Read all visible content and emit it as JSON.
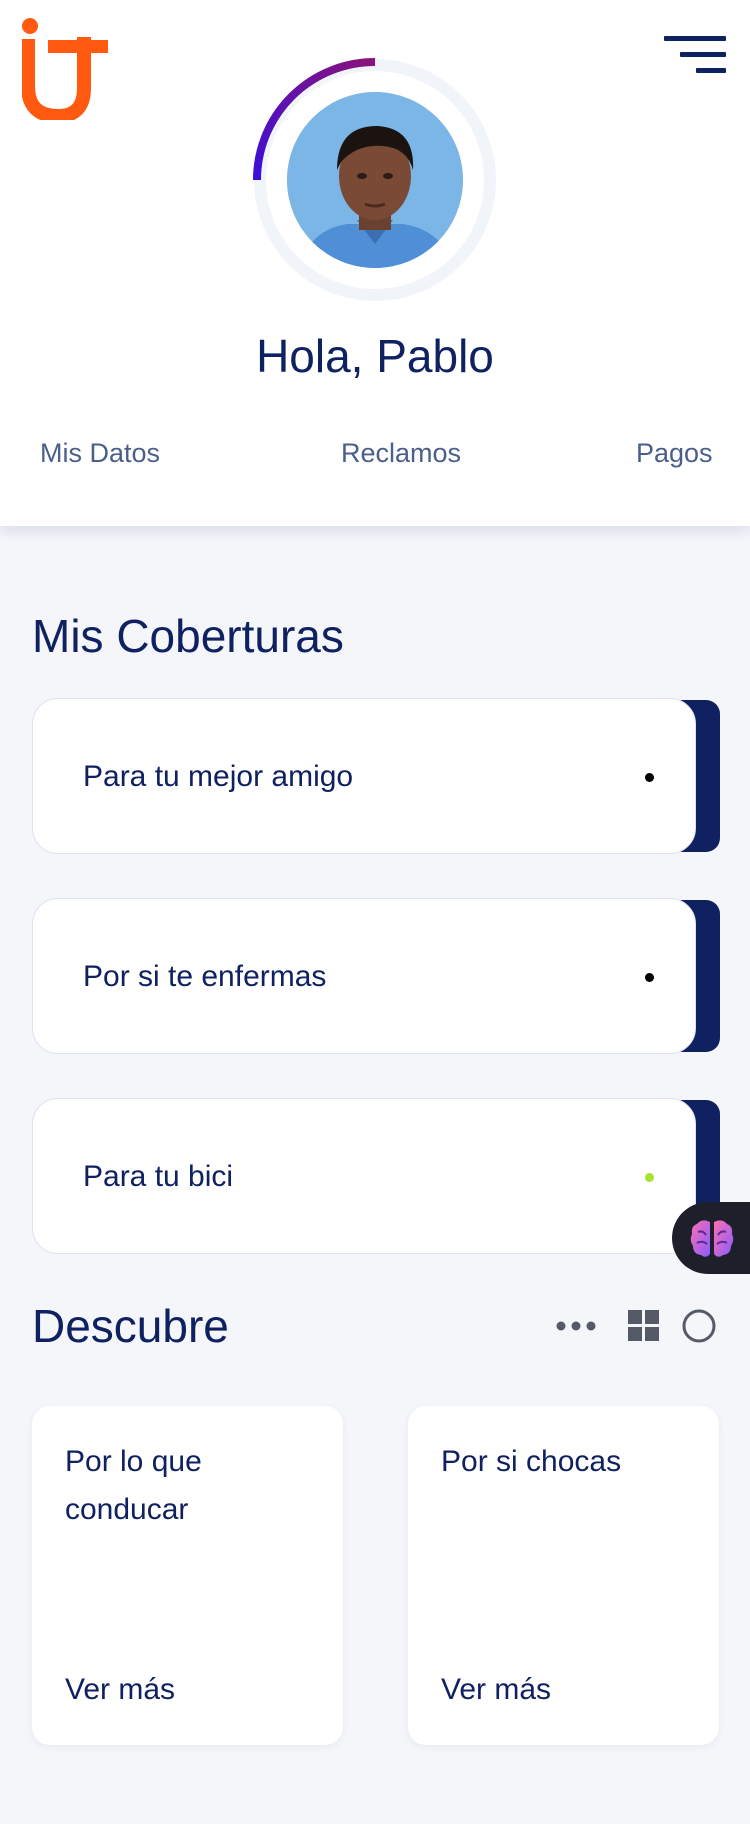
{
  "header": {
    "logo_name": "brand-logo",
    "greeting": "Hola, Pablo",
    "tabs": [
      {
        "label": "Mis Datos"
      },
      {
        "label": "Reclamos"
      },
      {
        "label": "Pagos"
      }
    ],
    "profile_progress": 0.25,
    "colors": {
      "logo": "#ff5a0f",
      "ring_start": "#3b10d8",
      "ring_end": "#8a137a",
      "ring_track": "#f1f4f8",
      "navy": "#0f2160"
    }
  },
  "coverages": {
    "title": "Mis Coberturas",
    "items": [
      {
        "label": "Para tu mejor amigo",
        "status_color": "#000000"
      },
      {
        "label": "Por si te enfermas",
        "status_color": "#000000"
      },
      {
        "label": "Para tu bici",
        "status_color": "#a6e22e"
      }
    ]
  },
  "ai_assistant": {
    "icon": "brain-icon"
  },
  "discover": {
    "title": "Descubre",
    "view_controls": [
      "more-dots-icon",
      "grid-view-icon",
      "circle-view-icon"
    ],
    "cards": [
      {
        "title": "Por lo que conducar",
        "cta": "Ver más"
      },
      {
        "title": "Por si chocas",
        "cta": "Ver más"
      }
    ]
  }
}
